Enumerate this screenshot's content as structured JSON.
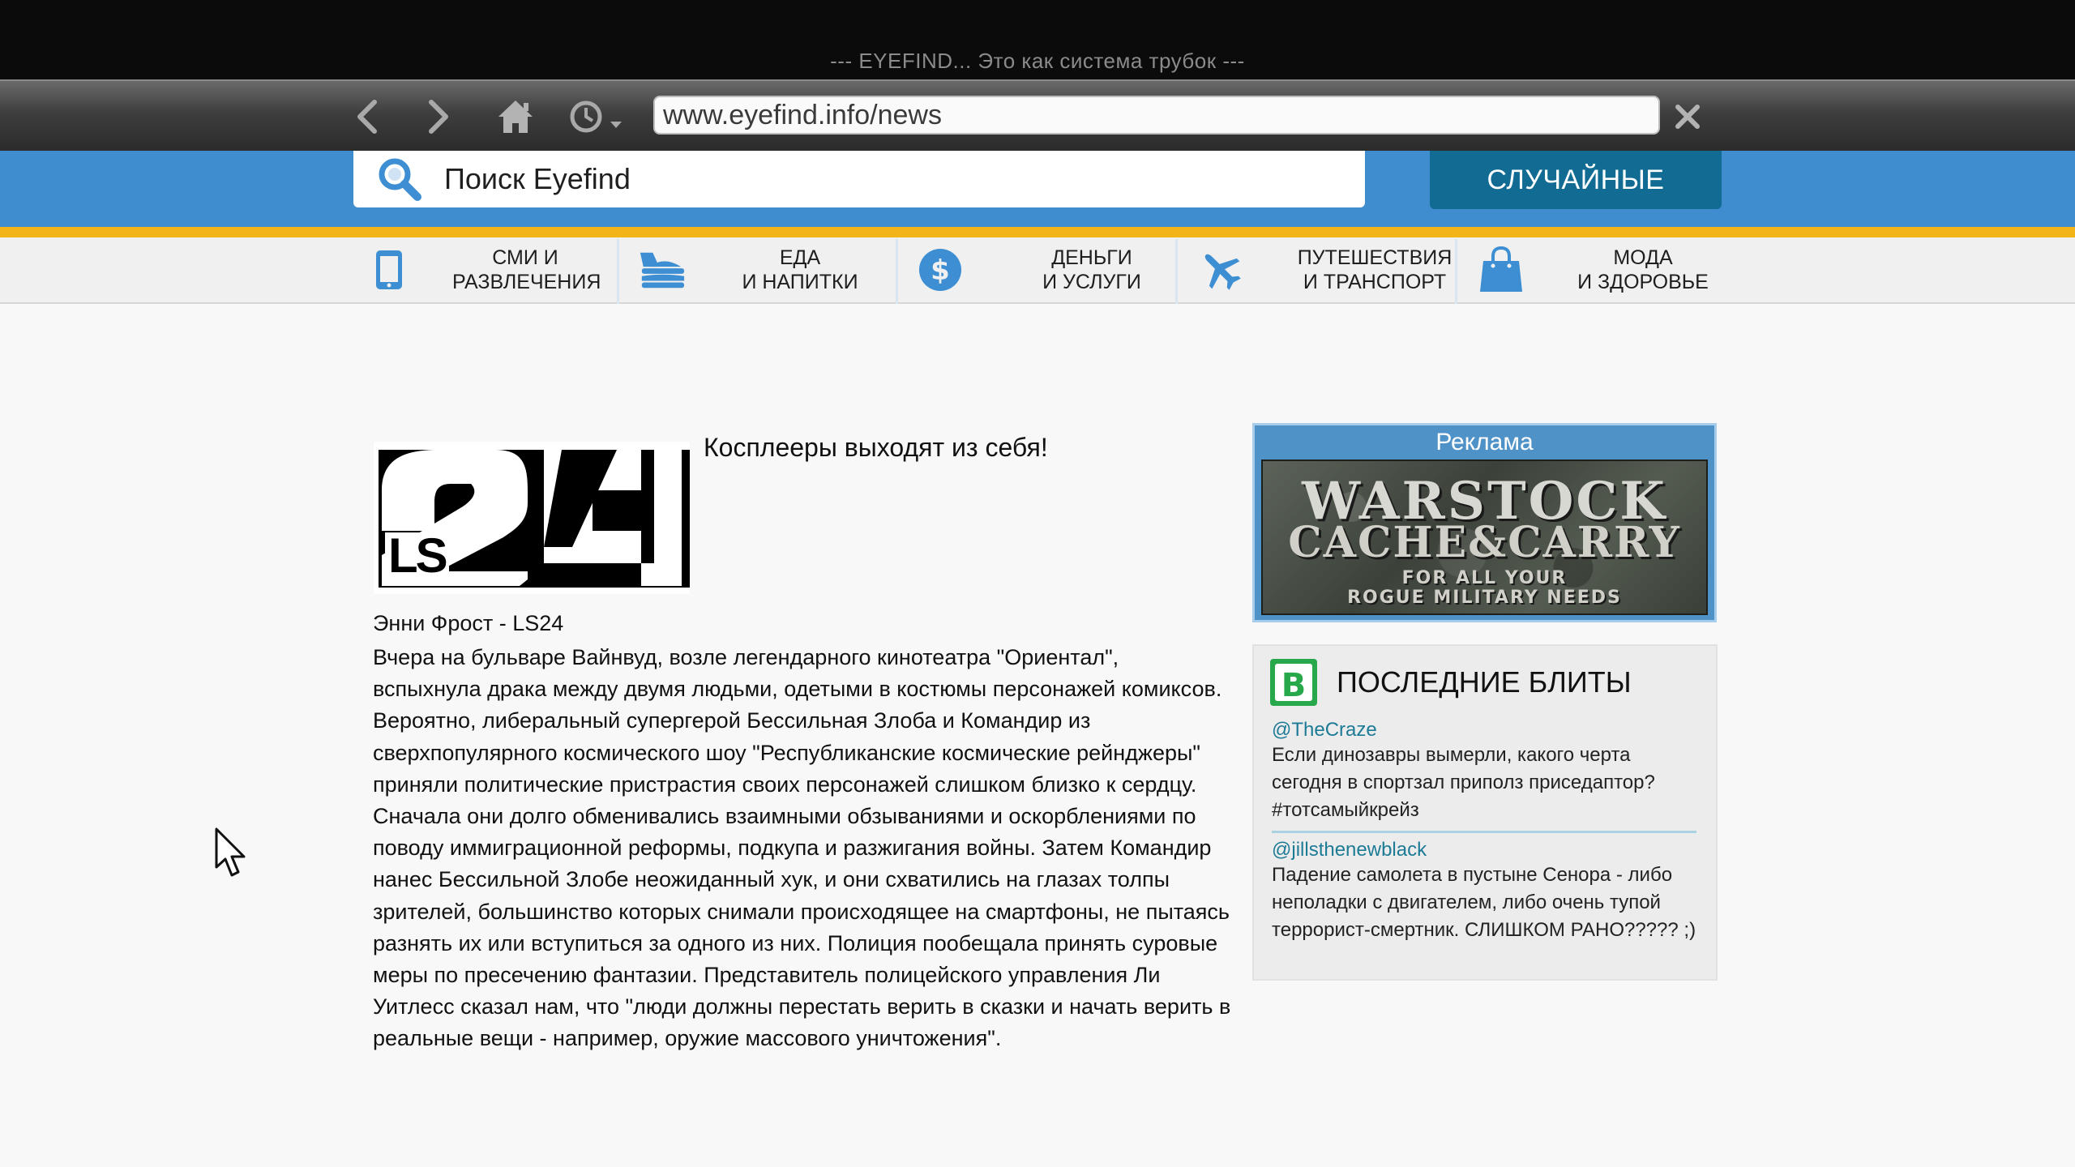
{
  "window": {
    "title": "--- EYEFIND... Это как система трубок ---"
  },
  "browser": {
    "back_icon": "chevron-left-icon",
    "forward_icon": "chevron-right-icon",
    "home_icon": "home-icon",
    "history_icon": "clock-icon",
    "url": "www.eyefind.info/news",
    "close_icon": "close-icon"
  },
  "header": {
    "search_placeholder": "Поиск Eyefind",
    "random_label": "СЛУЧАЙНЫЕ",
    "colors": {
      "blue": "#3f8ccf",
      "yellow": "#f2b418",
      "button": "#116b93",
      "icon": "#3d8ed2"
    }
  },
  "categories": [
    {
      "icon": "tablet-icon",
      "line1": "СМИ и",
      "line2": "развлечения"
    },
    {
      "icon": "food-icon",
      "line1": "Еда",
      "line2": "и напитки"
    },
    {
      "icon": "dollar-icon",
      "line1": "Деньги",
      "line2": "и услуги"
    },
    {
      "icon": "airplane-icon",
      "line1": "Путешествия",
      "line2": "и транспорт"
    },
    {
      "icon": "shopping-bag-icon",
      "line1": "Мода",
      "line2": "и здоровье"
    }
  ],
  "article": {
    "logo_text_big": "24",
    "logo_text_small": "LS",
    "title": "Косплееры выходят из себя!",
    "author": "Энни Фрост - LS24",
    "body": "Вчера на бульваре Вайнвуд, возле легендарного кинотеатра \"Ориентал\", вспыхнула драка между двумя людьми, одетыми в костюмы персонажей комиксов. Вероятно, либеральный супергерой Бессильная Злоба и Командир из сверхпопулярного космического шоу \"Республиканские космические рейнджеры\" приняли политические пристрастия своих персонажей слишком близко к сердцу. Сначала они долго обменивались взаимными обзываниями и оскорблениями по поводу иммиграционной реформы, подкупа и разжигания войны. Затем Командир нанес Бессильной Злобе неожиданный хук, и они схватились на глазах толпы зрителей, большинство которых снимали происходящее на смартфоны, не пытаясь разнять их или вступиться за одного из них. Полиция пообещала принять суровые меры по пресечению фантазии. Представитель полицейского управления Ли Уитлесс сказал нам, что \"люди должны перестать верить в сказки и начать верить в реальные вещи - например, оружие массового уничтожения\"."
  },
  "ad": {
    "label": "Реклама",
    "line1": "WARSTOCK",
    "line2": "CACHE&CARRY",
    "line3": "FOR ALL YOUR",
    "line4": "ROGUE MILITARY NEEDS"
  },
  "bleets": {
    "logo_letter": "B",
    "heading": "ПОСЛЕДНИЕ БЛИТЫ",
    "items": [
      {
        "handle": "@TheCraze",
        "text": "Если динозавры вымерли, какого черта сегодня в спортзал приполз приседаптор? #тотсамыйкрейз"
      },
      {
        "handle": "@jillsthenewblack",
        "text": "Падение самолета в пустыне Сенора - либо неполадки с двигателем, либо очень тупой террорист-смертник. СЛИШКОМ РАНО????? ;)"
      }
    ]
  }
}
